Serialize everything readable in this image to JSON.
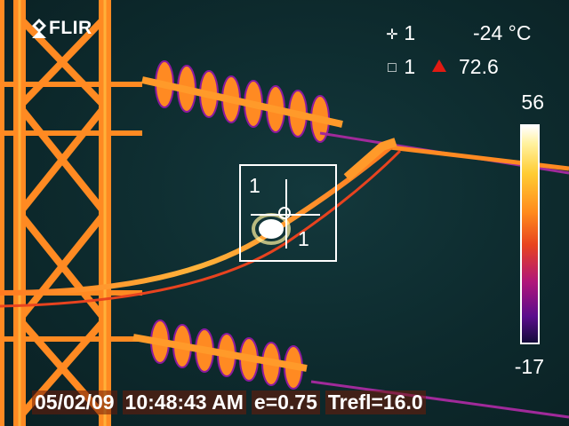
{
  "brand": {
    "logo_text": "FLIR",
    "icon": "flir-logo-icon"
  },
  "measurements": {
    "spot": {
      "icon": "crosshair-icon",
      "index": "1",
      "value": "-24 °C"
    },
    "box": {
      "icon": "box-icon",
      "index": "1",
      "max_icon": "max-triangle-icon",
      "value": "72.6"
    }
  },
  "scale": {
    "max": "56",
    "min": "-17",
    "palette": "iron"
  },
  "overlay": {
    "box_label": "1",
    "spot_label": "1"
  },
  "footer": {
    "date": "05/02/09",
    "time": "10:48:43 AM",
    "emissivity": "e=0.75",
    "trefl": "Trefl=16.0"
  },
  "colors": {
    "hot": "#ffffff",
    "warm": "#ffb02e",
    "mid": "#e8431f",
    "cool": "#8a1a9e",
    "background": "#0d2a2d",
    "max_marker": "#e11a12"
  }
}
